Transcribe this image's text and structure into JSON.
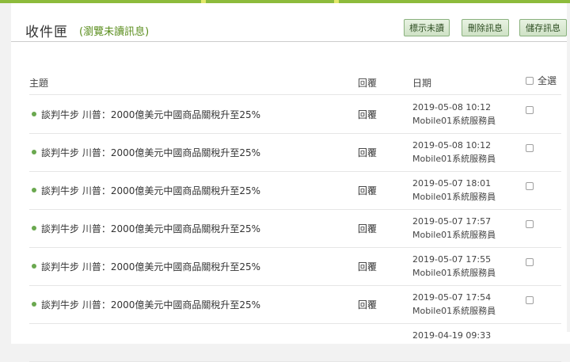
{
  "header": {
    "title": "收件匣",
    "subtitle": "(瀏覽未讀訊息)",
    "buttons": {
      "show_unread": "標示未讀",
      "delete": "刪除訊息",
      "save": "儲存訊息"
    }
  },
  "table": {
    "columns": {
      "subject": "主題",
      "reply": "回覆",
      "date": "日期",
      "select_all": "全選"
    },
    "rows": [
      {
        "subject": "談判牛步 川普：2000億美元中國商品關稅升至25%",
        "reply": "回覆",
        "date": "2019-05-08 10:12",
        "sender": "Mobile01系統服務員"
      },
      {
        "subject": "談判牛步 川普：2000億美元中國商品關稅升至25%",
        "reply": "回覆",
        "date": "2019-05-08 10:12",
        "sender": "Mobile01系統服務員"
      },
      {
        "subject": "談判牛步 川普：2000億美元中國商品關稅升至25%",
        "reply": "回覆",
        "date": "2019-05-07 18:01",
        "sender": "Mobile01系統服務員"
      },
      {
        "subject": "談判牛步 川普：2000億美元中國商品關稅升至25%",
        "reply": "回覆",
        "date": "2019-05-07 17:57",
        "sender": "Mobile01系統服務員"
      },
      {
        "subject": "談判牛步 川普：2000億美元中國商品關稅升至25%",
        "reply": "回覆",
        "date": "2019-05-07 17:55",
        "sender": "Mobile01系統服務員"
      },
      {
        "subject": "談判牛步 川普：2000億美元中國商品關稅升至25%",
        "reply": "回覆",
        "date": "2019-05-07 17:54",
        "sender": "Mobile01系統服務員"
      },
      {
        "subject": "",
        "reply": "",
        "date": "2019-04-19 09:33",
        "sender": ""
      }
    ]
  },
  "colors": {
    "accent_bar": "#8dbb3c",
    "unread_dot": "#6aa84f",
    "subtitle": "#5b8e1e"
  }
}
